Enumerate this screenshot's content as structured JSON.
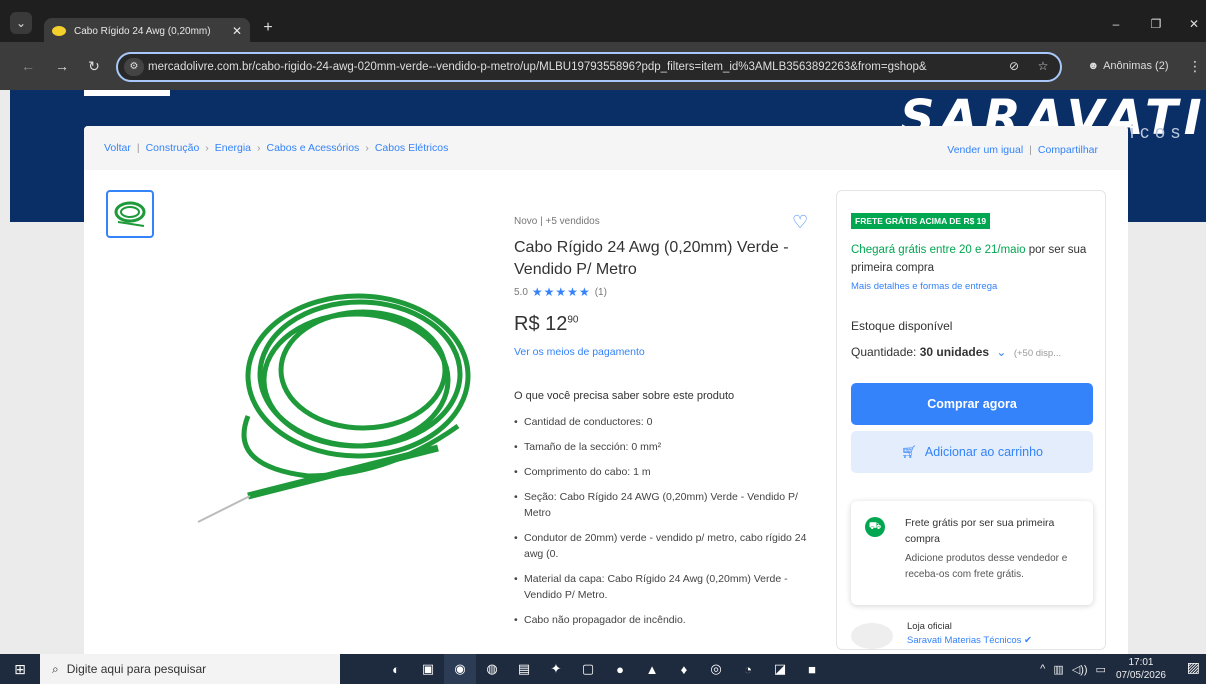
{
  "browser": {
    "tab_title": "Cabo Rígido 24 Awg (0,20mm)",
    "url": "mercadolivre.com.br/cabo-rigido-24-awg-020mm-verde--vendido-p-metro/up/MLBU1979355896?pdp_filters=item_id%3AMLB3563892263&from=gshop&",
    "profile": "Anônimas (2)"
  },
  "brand": {
    "name": "SARAVATI",
    "sub": "icos"
  },
  "breadcrumb": {
    "back": "Voltar",
    "items": [
      "Construção",
      "Energia",
      "Cabos e Acessórios",
      "Cabos Elétricos"
    ],
    "sell_similar": "Vender um igual",
    "share": "Compartilhar"
  },
  "product": {
    "condition": "Novo | +5 vendidos",
    "title": "Cabo Rígido 24 Awg (0,20mm) Verde - Vendido P/ Metro",
    "rating_value": "5.0",
    "rating_stars": 5,
    "rating_count": "(1)",
    "price_main": "R$ 12",
    "price_cents": "90",
    "payment_link": "Ver os meios de pagamento",
    "needs_title": "O que você precisa saber sobre este produto",
    "specs": [
      "Cantidad de conductores: 0",
      "Tamaño de la sección: 0 mm²",
      "Comprimento do cabo: 1 m",
      "Seção: Cabo Rígido 24 AWG (0,20mm) Verde - Vendido P/ Metro",
      "Condutor de 20mm) verde - vendido p/ metro, cabo rígido 24 awg (0.",
      "Material da capa: Cabo Rígido 24 Awg (0,20mm) Verde - Vendido P/ Metro.",
      "Cabo não propagador de incêndio."
    ]
  },
  "buybox": {
    "badge": "FRETE GRÁTIS ACIMA DE R$ 19",
    "delivery_green": "Chegará grátis entre 20 e 21/maio",
    "delivery_rest": " por ser sua primeira compra",
    "delivery_link": "Mais detalhes e formas de entrega",
    "stock": "Estoque disponível",
    "qty_label": "Quantidade: ",
    "qty_value": "30 unidades",
    "qty_avail": "(+50 disp...",
    "buy_now": "Comprar agora",
    "add_cart": "Adicionar ao carrinho",
    "promo_title": "Frete grátis por ser sua primeira compra",
    "promo_body": "Adicione produtos desse vendedor e receba-os com frete grátis.",
    "seller_kind": "Loja oficial",
    "seller_name": "Saravati Materias Técnicos"
  },
  "taskbar": {
    "search_placeholder": "Digite aqui para pesquisar",
    "time": "17:01",
    "date": "07/05/2026"
  },
  "colors": {
    "accent": "#3483fa",
    "green": "#00a650",
    "banner": "#0a2e66"
  }
}
